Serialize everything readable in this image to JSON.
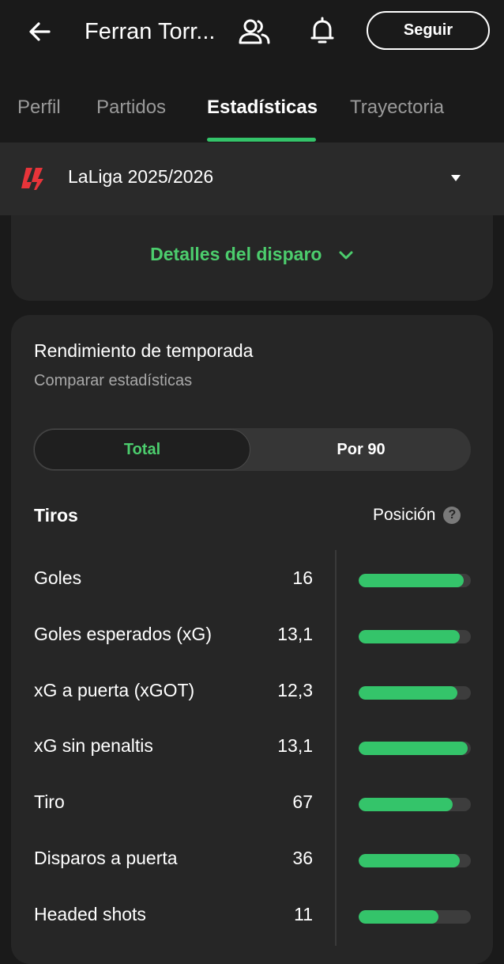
{
  "appbar": {
    "title": "Ferran Torr...",
    "follow_label": "Seguir",
    "icons": {
      "back": "back-arrow-icon",
      "people": "people-icon",
      "bell": "bell-icon"
    }
  },
  "tabs": [
    {
      "label": "Perfil",
      "active": false
    },
    {
      "label": "Partidos",
      "active": false
    },
    {
      "label": "Estadísticas",
      "active": true
    },
    {
      "label": "Trayectoria",
      "active": false
    }
  ],
  "league": {
    "name": "LaLiga 2025/2026",
    "logo": "laliga-logo",
    "caret": "caret-down-icon"
  },
  "shot_details": {
    "label": "Detalles del disparo",
    "icon": "chevron-down-icon"
  },
  "season": {
    "title": "Rendimiento de temporada",
    "subtitle": "Comparar estadísticas",
    "toggle": {
      "total": "Total",
      "per90": "Por 90",
      "selected": "Total"
    },
    "section_title": "Tiros",
    "position_label": "Posición",
    "help": "?",
    "stats": [
      {
        "label": "Goles",
        "value": "16",
        "percentile": 0.94
      },
      {
        "label": "Goles esperados (xG)",
        "value": "13,1",
        "percentile": 0.9
      },
      {
        "label": "xG a puerta (xGOT)",
        "value": "12,3",
        "percentile": 0.88
      },
      {
        "label": "xG sin penaltis",
        "value": "13,1",
        "percentile": 0.97
      },
      {
        "label": "Tiro",
        "value": "67",
        "percentile": 0.84
      },
      {
        "label": "Disparos a puerta",
        "value": "36",
        "percentile": 0.9
      },
      {
        "label": "Headed shots",
        "value": "11",
        "percentile": 0.71
      }
    ]
  },
  "colors": {
    "accent": "#34c46a",
    "accent_text": "#4ccd6d",
    "background": "#1a1a1a",
    "card": "#262626",
    "laliga_red": "#e8343a"
  }
}
